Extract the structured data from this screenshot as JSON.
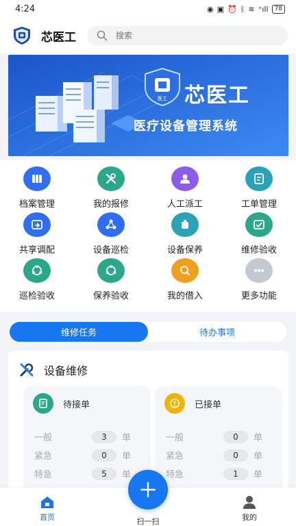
{
  "status_bar": {
    "time": "4:24",
    "signal": "⁺ıll",
    "battery": "78"
  },
  "header": {
    "app_name": "芯医工",
    "search_placeholder": "搜索"
  },
  "banner": {
    "title": "芯医工",
    "subtitle": "医疗设备管理系统",
    "badge_text": "医工"
  },
  "menu": [
    {
      "label": "档案管理",
      "icon": "archive-icon",
      "color": "#2f6ef2"
    },
    {
      "label": "我的报修",
      "icon": "tools-icon",
      "color": "#2aa889"
    },
    {
      "label": "人工派工",
      "icon": "worker-icon",
      "color": "#8c5ce8"
    },
    {
      "label": "工单管理",
      "icon": "clipboard-icon",
      "color": "#2aa3b8"
    },
    {
      "label": "共享调配",
      "icon": "share-icon",
      "color": "#2f6ef2"
    },
    {
      "label": "设备巡检",
      "icon": "inspect-icon",
      "color": "#2f6ef2"
    },
    {
      "label": "设备保养",
      "icon": "maintain-icon",
      "color": "#2aa3b8"
    },
    {
      "label": "维修验收",
      "icon": "check-icon",
      "color": "#2aa889"
    },
    {
      "label": "巡检验收",
      "icon": "cycle-icon",
      "color": "#2aa889"
    },
    {
      "label": "保养验收",
      "icon": "cycle-icon",
      "color": "#2aa889"
    },
    {
      "label": "我的借入",
      "icon": "borrow-icon",
      "color": "#f0a020"
    },
    {
      "label": "更多功能",
      "icon": "more-icon",
      "color": "#c4c8cf"
    }
  ],
  "tabs": {
    "active": "维修任务",
    "inactive": "待办事项"
  },
  "card": {
    "title": "设备维修",
    "pending": {
      "title": "待接单",
      "rows": [
        {
          "label": "一般",
          "value": "3",
          "unit": "单"
        },
        {
          "label": "紧急",
          "value": "0",
          "unit": "单"
        },
        {
          "label": "特急",
          "value": "5",
          "unit": "单"
        }
      ]
    },
    "accepted": {
      "title": "已接单",
      "rows": [
        {
          "label": "一般",
          "value": "0",
          "unit": "单"
        },
        {
          "label": "紧急",
          "value": "0",
          "unit": "单"
        },
        {
          "label": "特急",
          "value": "1",
          "unit": "单"
        }
      ]
    }
  },
  "bottom_nav": {
    "home": "首页",
    "scan": "扫一扫",
    "mine": "我的"
  },
  "colors": {
    "accent": "#1677f0",
    "banner": "#2f7ff0"
  }
}
